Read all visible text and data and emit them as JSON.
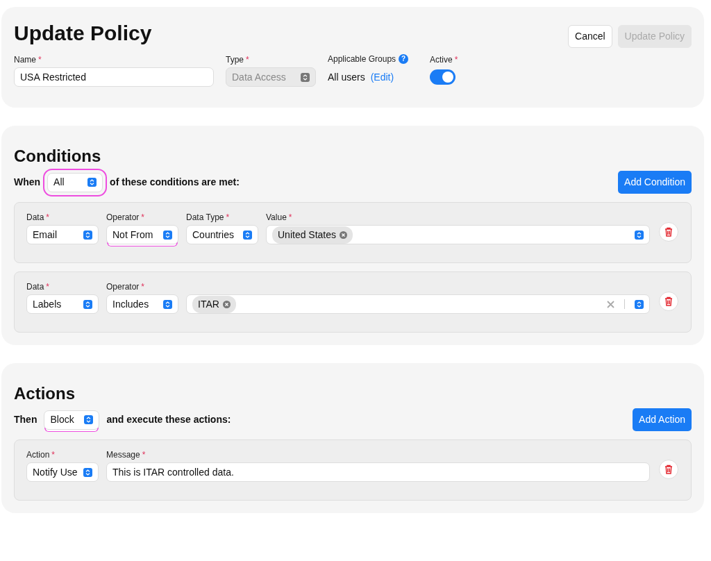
{
  "header": {
    "title": "Update Policy",
    "buttons": [
      {
        "label": "Cancel",
        "disabled": false
      },
      {
        "label": "Update Policy",
        "disabled": true
      }
    ],
    "name": {
      "label": "Name",
      "required_mark": "*",
      "value": "USA Restricted"
    },
    "type": {
      "label": "Type",
      "required_mark": "*",
      "value": "Data Access",
      "disabled": true
    },
    "groups": {
      "label": "Applicable Groups",
      "help": "?",
      "value": "All users",
      "link": "(Edit)"
    },
    "active": {
      "label": "Active",
      "required_mark": "*",
      "on": true
    }
  },
  "sections": [
    {
      "title": "Conditions",
      "prefix": "When",
      "select": {
        "value": "All",
        "boxed": true
      },
      "suffix": "of these conditions are met:",
      "add_button": "Add Condition",
      "rows": [
        {
          "fields": [
            {
              "kind": "select",
              "label": "Data",
              "required_mark": "*",
              "value": "Email"
            },
            {
              "kind": "select",
              "label": "Operator",
              "required_mark": "*",
              "value": "Not From",
              "underlined": true
            },
            {
              "kind": "select",
              "label": "Data Type",
              "required_mark": "*",
              "value": "Countries"
            },
            {
              "kind": "tags",
              "label": "Value",
              "required_mark": "*",
              "tags": [
                "United States"
              ]
            }
          ]
        },
        {
          "fields": [
            {
              "kind": "select",
              "label": "Data",
              "required_mark": "*",
              "value": "Labels"
            },
            {
              "kind": "select",
              "label": "Operator",
              "required_mark": "*",
              "value": "Includes"
            },
            {
              "kind": "tags",
              "tags": [
                "ITAR"
              ],
              "clearable": true
            }
          ]
        }
      ]
    },
    {
      "title": "Actions",
      "prefix": "Then",
      "select": {
        "value": "Block",
        "underlined": true
      },
      "suffix": "and execute these actions:",
      "add_button": "Add Action",
      "rows": [
        {
          "fields": [
            {
              "kind": "select",
              "label": "Action",
              "required_mark": "*",
              "value": "Notify Use"
            },
            {
              "kind": "text",
              "label": "Message",
              "required_mark": "*",
              "value": "This is ITAR controlled data."
            }
          ]
        }
      ]
    }
  ]
}
